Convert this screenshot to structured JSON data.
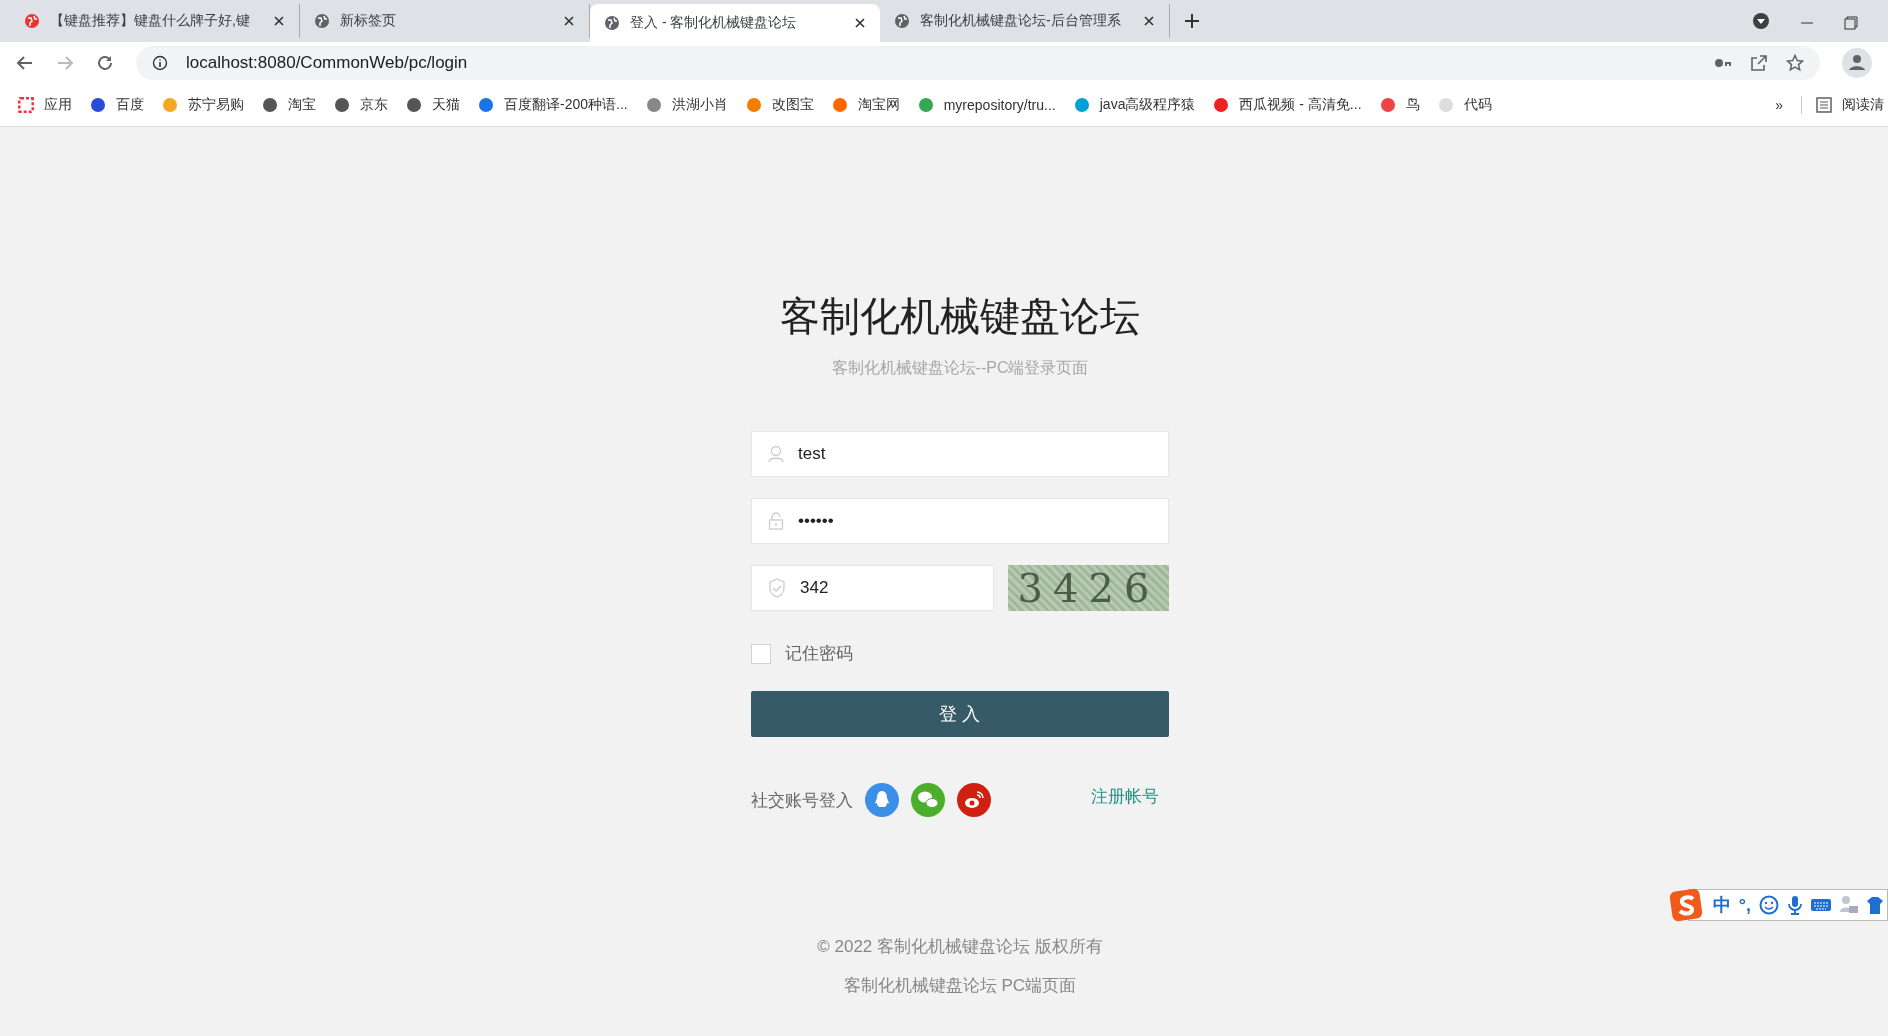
{
  "browser": {
    "tabs": [
      {
        "title": "【键盘推荐】键盘什么牌子好,键",
        "selected": false
      },
      {
        "title": "新标签页",
        "selected": false
      },
      {
        "title": "登入 - 客制化机械键盘论坛",
        "selected": true
      },
      {
        "title": "客制化机械键盘论坛-后台管理系",
        "selected": false
      }
    ],
    "url": "localhost:8080/CommonWeb/pc/login",
    "bookmarks": [
      "应用",
      "百度",
      "苏宁易购",
      "淘宝",
      "京东",
      "天猫",
      "百度翻译-200种语...",
      "洪湖小肖",
      "改图宝",
      "淘宝网",
      "myrepository/tru...",
      "java高级程序猿",
      "西瓜视频 - 高清免...",
      "鸟",
      "代码"
    ],
    "bookmarks_overflow": "»",
    "reading_list": "阅读清"
  },
  "page": {
    "title": "客制化机械键盘论坛",
    "subtitle": "客制化机械键盘论坛--PC端登录页面",
    "username": {
      "value": "test"
    },
    "password": {
      "value": "••••••"
    },
    "captcha": {
      "value": "342",
      "image_text": "3426"
    },
    "remember": {
      "label": "记住密码",
      "checked": false
    },
    "login_button": "登 入",
    "social_label": "社交账号登入",
    "register_link": "注册帐号",
    "footer": [
      "© 2022 客制化机械键盘论坛 版权所有",
      "客制化机械键盘论坛 PC端页面"
    ]
  },
  "ime": {
    "mode": "中",
    "punct": "°,"
  }
}
